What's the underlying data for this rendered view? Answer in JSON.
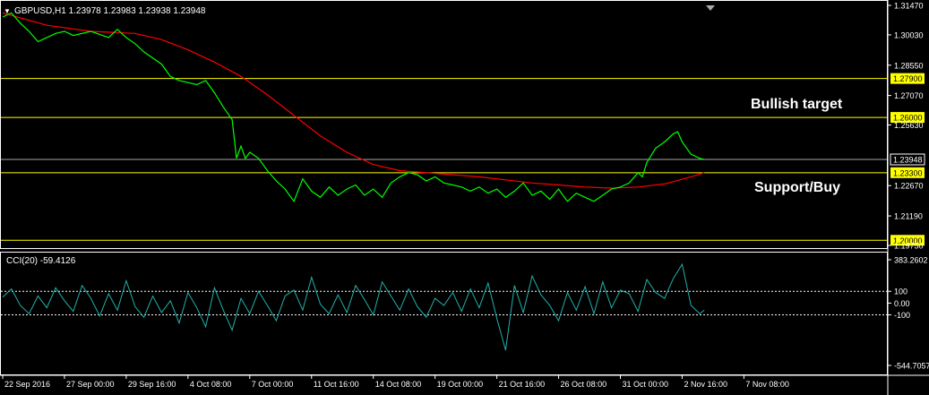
{
  "header": {
    "arrow": "▼",
    "text": "GBPUSD,H1  1.23978 1.23983 1.23938 1.23948"
  },
  "annotations": {
    "bullish": "Bullish target",
    "support": "Support/Buy"
  },
  "colors": {
    "background": "#000000",
    "frame": "#ffffff",
    "price": "#00ff00",
    "ma": "#ff0000",
    "level": "#ffff00",
    "current": "#a9a9a9",
    "cci": "#20b2aa",
    "text": "#ffffff"
  },
  "chart_data": [
    {
      "type": "line",
      "title": "GBPUSD,H1  1.23978 1.23983 1.23938 1.23948",
      "ylim": [
        1.1975,
        1.3147
      ],
      "y_ticks": [
        "1.31470",
        "1.30030",
        "1.28550",
        "1.27070",
        "1.25630",
        "1.22670",
        "1.21190",
        "1.19750"
      ],
      "x_ticks": [
        "22 Sep 2016",
        "27 Sep 00:00",
        "29 Sep 16:00",
        "4 Oct 08:00",
        "7 Oct 00:00",
        "11 Oct 16:00",
        "14 Oct 08:00",
        "19 Oct 00:00",
        "21 Oct 16:00",
        "26 Oct 08:00",
        "31 Oct 00:00",
        "2 Nov 16:00",
        "7 Nov 08:00"
      ],
      "x_positions": [
        0,
        0.07,
        0.14,
        0.21,
        0.28,
        0.35,
        0.42,
        0.49,
        0.56,
        0.63,
        0.7,
        0.77,
        0.84
      ],
      "horizontal_levels": [
        {
          "value": 1.279,
          "label": "1.27900"
        },
        {
          "value": 1.26,
          "label": "1.26000"
        },
        {
          "value": 1.233,
          "label": "1.23300"
        },
        {
          "value": 1.2,
          "label": "1.20000"
        }
      ],
      "current_price": {
        "value": 1.23948,
        "label": "1.23948"
      },
      "series": [
        {
          "kind": "price",
          "x": [
            0,
            0.01,
            0.02,
            0.03,
            0.04,
            0.05,
            0.06,
            0.07,
            0.08,
            0.1,
            0.12,
            0.13,
            0.14,
            0.15,
            0.16,
            0.18,
            0.19,
            0.2,
            0.22,
            0.23,
            0.24,
            0.25,
            0.26,
            0.265,
            0.27,
            0.275,
            0.28,
            0.29,
            0.3,
            0.31,
            0.32,
            0.33,
            0.34,
            0.35,
            0.36,
            0.37,
            0.38,
            0.39,
            0.4,
            0.41,
            0.42,
            0.43,
            0.44,
            0.45,
            0.46,
            0.47,
            0.48,
            0.49,
            0.5,
            0.51,
            0.52,
            0.53,
            0.54,
            0.55,
            0.56,
            0.57,
            0.58,
            0.59,
            0.6,
            0.61,
            0.62,
            0.63,
            0.64,
            0.65,
            0.66,
            0.67,
            0.68,
            0.69,
            0.7,
            0.71,
            0.72,
            0.725,
            0.73,
            0.74,
            0.75,
            0.76,
            0.765,
            0.77,
            0.78,
            0.79,
            0.795
          ],
          "values": [
            1.309,
            1.311,
            1.306,
            1.302,
            1.297,
            1.299,
            1.301,
            1.302,
            1.3,
            1.302,
            1.299,
            1.303,
            1.299,
            1.296,
            1.292,
            1.286,
            1.28,
            1.278,
            1.276,
            1.278,
            1.272,
            1.265,
            1.259,
            1.24,
            1.246,
            1.24,
            1.243,
            1.24,
            1.234,
            1.229,
            1.225,
            1.219,
            1.23,
            1.224,
            1.221,
            1.226,
            1.222,
            1.225,
            1.227,
            1.222,
            1.225,
            1.221,
            1.228,
            1.231,
            1.233,
            1.232,
            1.229,
            1.231,
            1.228,
            1.227,
            1.226,
            1.224,
            1.226,
            1.223,
            1.225,
            1.221,
            1.224,
            1.228,
            1.222,
            1.224,
            1.22,
            1.225,
            1.219,
            1.223,
            1.221,
            1.219,
            1.222,
            1.225,
            1.226,
            1.228,
            1.233,
            1.231,
            1.238,
            1.245,
            1.248,
            1.252,
            1.253,
            1.248,
            1.242,
            1.24,
            1.2395
          ]
        },
        {
          "kind": "moving-average",
          "x": [
            0,
            0.05,
            0.1,
            0.15,
            0.18,
            0.21,
            0.24,
            0.27,
            0.3,
            0.33,
            0.36,
            0.39,
            0.42,
            0.45,
            0.48,
            0.51,
            0.54,
            0.57,
            0.6,
            0.63,
            0.66,
            0.69,
            0.72,
            0.75,
            0.78,
            0.795
          ],
          "values": [
            1.311,
            1.305,
            1.302,
            1.301,
            1.298,
            1.293,
            1.287,
            1.28,
            1.271,
            1.261,
            1.251,
            1.243,
            1.237,
            1.234,
            1.233,
            1.232,
            1.231,
            1.2295,
            1.228,
            1.227,
            1.226,
            1.2255,
            1.226,
            1.2275,
            1.231,
            1.233
          ]
        }
      ]
    },
    {
      "type": "line",
      "title": "CCI(20) -59.4126",
      "ylim": [
        -544.7057,
        383.2602
      ],
      "y_ticks": [
        "383.2602",
        "100",
        "0.00",
        "-100",
        "-544.7057"
      ],
      "levels": [
        100,
        -100
      ],
      "series": [
        {
          "kind": "cci",
          "x": [
            0,
            0.01,
            0.02,
            0.03,
            0.04,
            0.05,
            0.06,
            0.07,
            0.08,
            0.09,
            0.1,
            0.11,
            0.12,
            0.13,
            0.14,
            0.15,
            0.16,
            0.17,
            0.18,
            0.19,
            0.2,
            0.21,
            0.22,
            0.23,
            0.24,
            0.25,
            0.26,
            0.27,
            0.28,
            0.29,
            0.3,
            0.31,
            0.32,
            0.33,
            0.34,
            0.35,
            0.36,
            0.37,
            0.38,
            0.39,
            0.4,
            0.41,
            0.42,
            0.43,
            0.44,
            0.45,
            0.46,
            0.47,
            0.48,
            0.49,
            0.5,
            0.51,
            0.52,
            0.53,
            0.54,
            0.55,
            0.56,
            0.57,
            0.58,
            0.59,
            0.6,
            0.61,
            0.62,
            0.63,
            0.64,
            0.65,
            0.66,
            0.67,
            0.68,
            0.69,
            0.7,
            0.71,
            0.72,
            0.73,
            0.74,
            0.75,
            0.76,
            0.77,
            0.78,
            0.79,
            0.795
          ],
          "values": [
            50,
            120,
            -20,
            -90,
            60,
            -40,
            130,
            20,
            -70,
            150,
            40,
            -110,
            80,
            -60,
            190,
            -30,
            -120,
            60,
            -80,
            20,
            -170,
            90,
            -40,
            -200,
            130,
            -60,
            -230,
            40,
            -90,
            100,
            -20,
            -150,
            60,
            110,
            -60,
            220,
            -10,
            -90,
            70,
            -80,
            150,
            30,
            -100,
            180,
            60,
            -60,
            120,
            -30,
            -120,
            40,
            -20,
            90,
            -70,
            120,
            -40,
            170,
            -130,
            -400,
            150,
            -80,
            230,
            70,
            -20,
            -150,
            90,
            -60,
            140,
            -90,
            180,
            -40,
            110,
            80,
            -70,
            200,
            90,
            40,
            210,
            330,
            -20,
            -90,
            -59.41
          ]
        }
      ]
    }
  ]
}
